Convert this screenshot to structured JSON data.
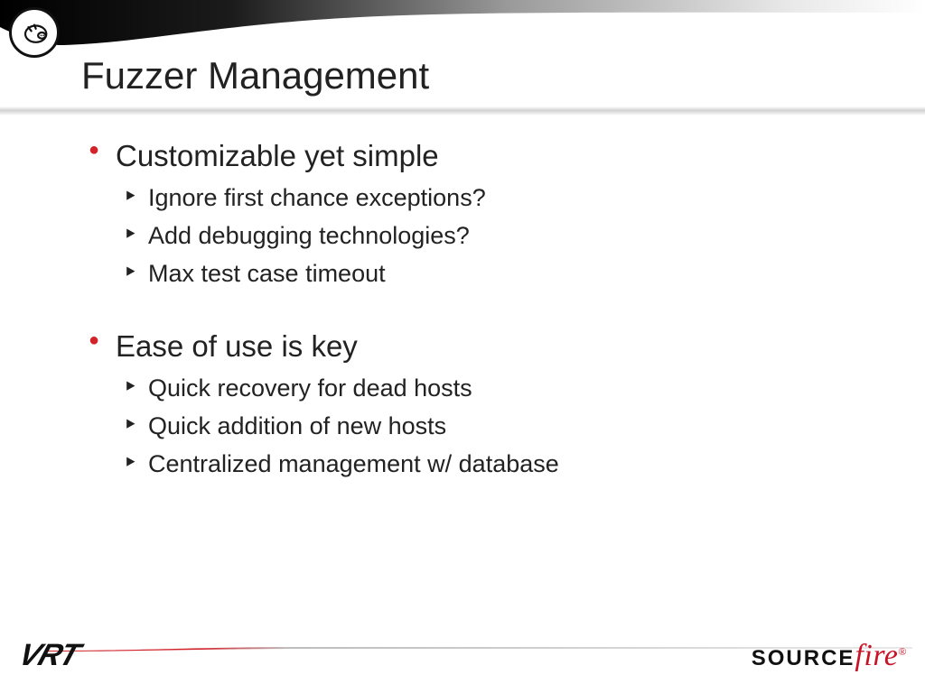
{
  "title": "Fuzzer Management",
  "bullets": {
    "group1": {
      "head": "Customizable yet simple",
      "items": [
        "Ignore first chance exceptions?",
        "Add debugging technologies?",
        "Max test case timeout"
      ]
    },
    "group2": {
      "head": "Ease of use is key",
      "items": [
        "Quick recovery for dead hosts",
        "Quick addition of new hosts",
        "Centralized management w/ database"
      ]
    }
  },
  "footer": {
    "left_logo": "VRT",
    "right_logo_source": "SOURCE",
    "right_logo_fire": "fire",
    "right_logo_reg": "®"
  },
  "colors": {
    "accent_red": "#d2222a",
    "brand_red": "#c81327"
  }
}
